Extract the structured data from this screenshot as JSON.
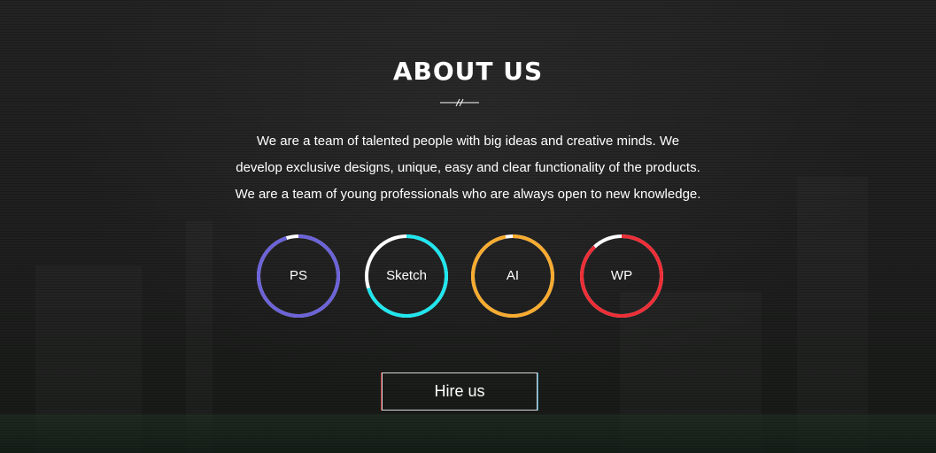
{
  "section": {
    "title": "ABOUT US",
    "description_lines": [
      "We are a team of talented people with big ideas and creative minds. We",
      "develop exclusive designs, unique, easy and clear functionality of the products.",
      "We are a team of young professionals who are always open to new knowledge."
    ]
  },
  "skills": [
    {
      "label": "PS",
      "color": "#6c63d9",
      "track_color": "#ffffff",
      "level": 0.95
    },
    {
      "label": "Sketch",
      "color": "#1fe6ee",
      "track_color": "#ffffff",
      "level": 0.7
    },
    {
      "label": "AI",
      "color": "#f8ab2f",
      "track_color": "#ffffff",
      "level": 0.97
    },
    {
      "label": "WP",
      "color": "#ee2e37",
      "track_color": "#ffffff",
      "level": 0.88
    }
  ],
  "cta": {
    "hire_label": "Hire us"
  },
  "colors": {
    "background": "#1f1f1f",
    "text": "#ffffff",
    "button_border": "#d8d8d8"
  }
}
